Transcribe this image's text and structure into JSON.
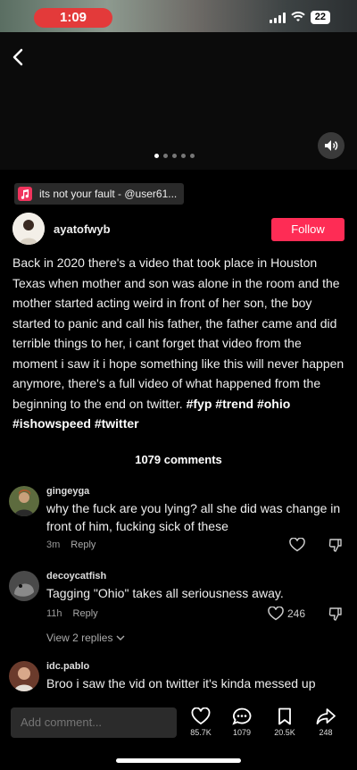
{
  "status_bar": {
    "time": "1:09",
    "battery": "22"
  },
  "post": {
    "sound_label": "its not your fault - @user61...",
    "author": "ayatofwyb",
    "follow_label": "Follow",
    "caption_text": "Back in 2020 there's a video that took place in Houston Texas when mother and son was alone in the room and the mother started acting weird in front of her son, the boy started to panic and call his father, the father came and did terrible things to her, i cant forget that video from the moment i saw it i hope something like this will never happen anymore, there's a full video of what happened from the beginning to the end on twitter.",
    "hashtags": [
      "#fyp",
      "#trend",
      "#ohio",
      "#ishowspeed",
      "#twitter"
    ]
  },
  "comments_header": "1079 comments",
  "comments": [
    {
      "user": "gingeyga",
      "text": "why the fuck are you lying? all she did was change in front of him, fucking sick of these",
      "age": "3m",
      "reply_label": "Reply",
      "likes": ""
    },
    {
      "user": "decoycatfish",
      "text": "Tagging \"Ohio\" takes all seriousness away.",
      "age": "11h",
      "reply_label": "Reply",
      "likes": "246"
    },
    {
      "user": "idc.pablo",
      "text": "Broo i saw the vid on twitter it's kinda messed up",
      "age": "",
      "reply_label": "",
      "likes": ""
    }
  ],
  "view_replies_label": "View 2 replies",
  "bottom_bar": {
    "add_comment_placeholder": "Add comment...",
    "likes": "85.7K",
    "comments": "1079",
    "saves": "20.5K",
    "shares": "248"
  },
  "colors": {
    "accent": "#fe2c55",
    "status_pill": "#e33a3a"
  }
}
